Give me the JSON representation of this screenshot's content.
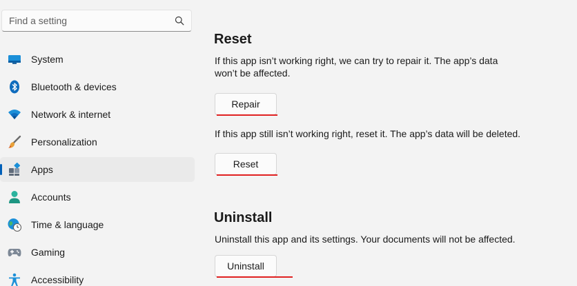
{
  "search": {
    "placeholder": "Find a setting"
  },
  "sidebar": {
    "items": [
      {
        "label": "System",
        "icon": "system-icon"
      },
      {
        "label": "Bluetooth & devices",
        "icon": "bluetooth-icon"
      },
      {
        "label": "Network & internet",
        "icon": "wifi-icon"
      },
      {
        "label": "Personalization",
        "icon": "brush-icon"
      },
      {
        "label": "Apps",
        "icon": "apps-icon",
        "selected": true
      },
      {
        "label": "Accounts",
        "icon": "person-icon"
      },
      {
        "label": "Time & language",
        "icon": "globe-clock-icon"
      },
      {
        "label": "Gaming",
        "icon": "gamepad-icon"
      },
      {
        "label": "Accessibility",
        "icon": "accessibility-icon"
      }
    ]
  },
  "reset_section": {
    "title": "Reset",
    "repair_desc": "If this app isn’t working right, we can try to repair it. The app’s data won’t be affected.",
    "repair_button": "Repair",
    "reset_desc": "If this app still isn’t working right, reset it. The app’s data will be deleted.",
    "reset_button": "Reset"
  },
  "uninstall_section": {
    "title": "Uninstall",
    "desc": "Uninstall this app and its settings. Your documents will not be affected.",
    "button": "Uninstall"
  },
  "colors": {
    "accent": "#005fb8",
    "annotation_underline": "#e02020",
    "background": "#f3f3f3"
  }
}
